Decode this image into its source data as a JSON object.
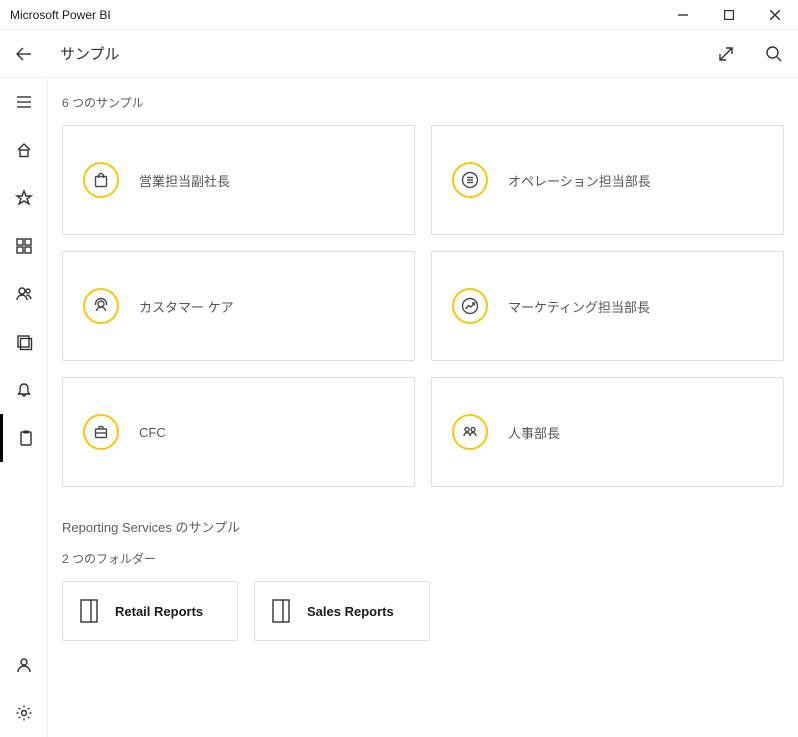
{
  "window": {
    "title": "Microsoft Power BI"
  },
  "page": {
    "title": "サンプル",
    "samples_count": "6 つのサンプル"
  },
  "samples": {
    "items": [
      {
        "label": "営業担当副社長"
      },
      {
        "label": "オペレーション担当部長"
      },
      {
        "label": "カスタマー ケア"
      },
      {
        "label": "マーケティング担当部長"
      },
      {
        "label": "CFC"
      },
      {
        "label": "人事部長"
      }
    ]
  },
  "reporting": {
    "header": "Reporting Services のサンプル",
    "folders_count": "2 つのフォルダー",
    "folders": [
      {
        "label": "Retail Reports"
      },
      {
        "label": "Sales Reports"
      }
    ]
  }
}
